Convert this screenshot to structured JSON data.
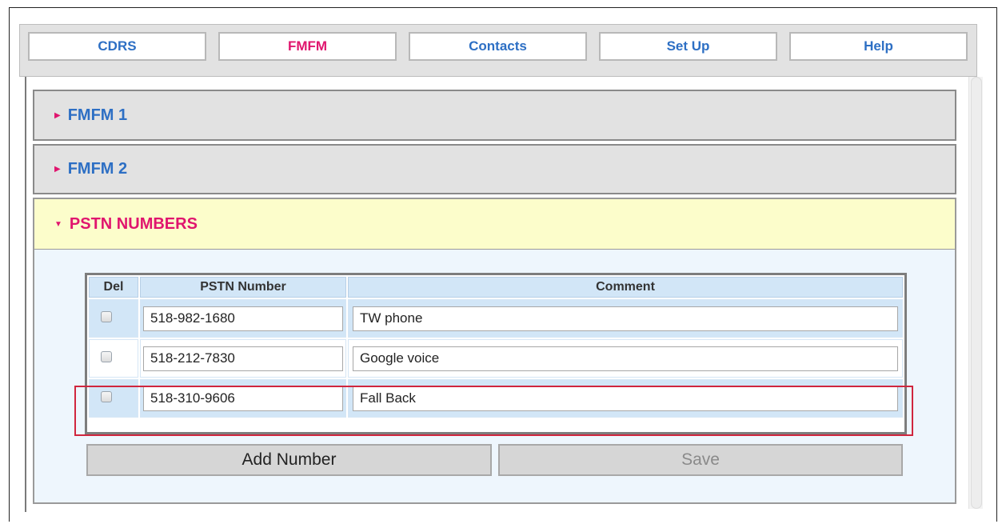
{
  "nav": {
    "tabs": [
      {
        "label": "CDRS"
      },
      {
        "label": "FMFM"
      },
      {
        "label": "Contacts"
      },
      {
        "label": "Set Up"
      },
      {
        "label": "Help"
      }
    ],
    "active": "FMFM"
  },
  "sections": [
    {
      "title": "FMFM 1",
      "expanded": false
    },
    {
      "title": "FMFM 2",
      "expanded": false
    },
    {
      "title": "PSTN NUMBERS",
      "expanded": true
    }
  ],
  "table": {
    "headers": {
      "del": "Del",
      "number": "PSTN Number",
      "comment": "Comment"
    },
    "rows": [
      {
        "number": "518-982-1680",
        "comment": "TW phone",
        "checked": false
      },
      {
        "number": "518-212-7830",
        "comment": "Google voice",
        "checked": false
      },
      {
        "number": "518-310-9606",
        "comment": "Fall Back",
        "checked": false
      }
    ]
  },
  "actions": {
    "add_label": "Add Number",
    "save_label": "Save"
  },
  "colors": {
    "accent_blue": "#2d6fc4",
    "accent_pink": "#e0156e",
    "highlight_red": "#d0263e"
  }
}
